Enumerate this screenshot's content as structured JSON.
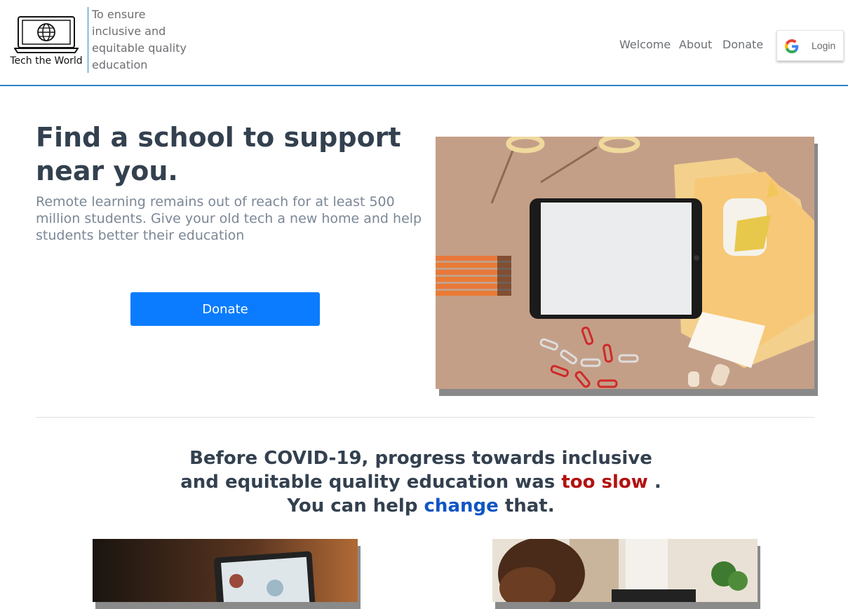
{
  "header": {
    "logo_text": "Tech the World",
    "tagline": "To ensure inclusive and equitable quality education",
    "nav": [
      {
        "label": "Welcome"
      },
      {
        "label": "About"
      },
      {
        "label": "Donate"
      }
    ],
    "login_label": "Login",
    "accent_color": "#2b82c9"
  },
  "hero": {
    "title": "Find a school to support near you.",
    "subtitle": "Remote learning remains out of reach for at least 500 million students. Give your old tech a new home and help students better their education",
    "donate_label": "Donate",
    "button_color": "#0b7cff"
  },
  "mission": {
    "line1": "Before COVID-19, progress towards inclusive",
    "line2_pre": "and equitable quality education was",
    "line2_highlight": "too slow",
    "line2_post": ".",
    "line3_pre": "You can help",
    "line3_highlight": "change",
    "line3_post": "that.",
    "highlight_red": "#b31212",
    "highlight_blue": "#0f55c4"
  },
  "icons": [
    "laptop-globe-logo-icon",
    "google-icon"
  ]
}
